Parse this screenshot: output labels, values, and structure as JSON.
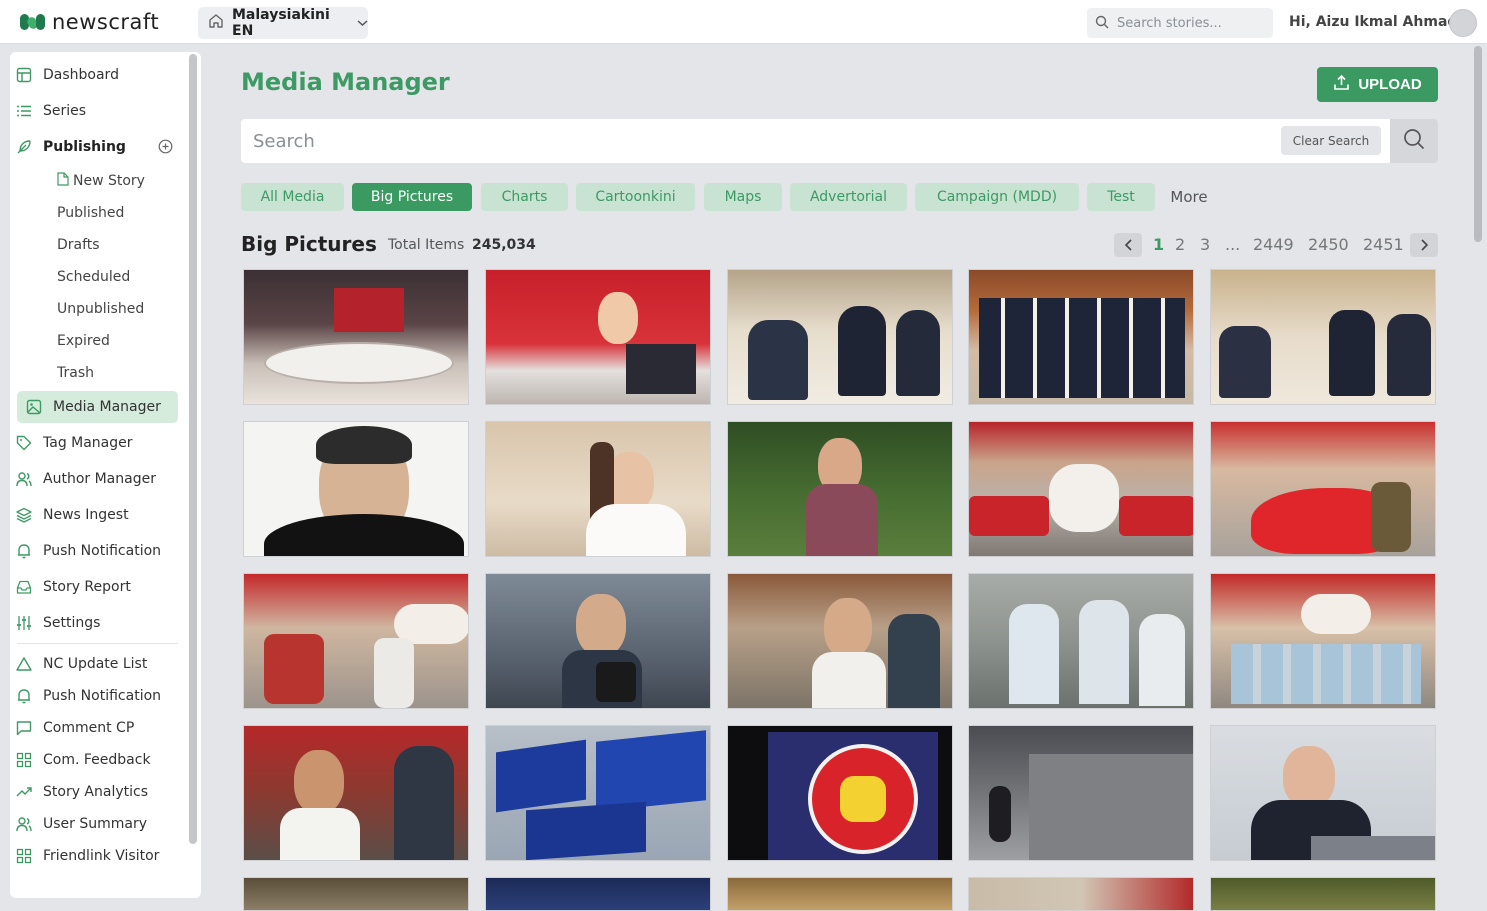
{
  "app": {
    "logo_text": "newscraft",
    "site_selector": "Malaysiakini EN",
    "search_placeholder": "Search stories...",
    "greeting": "Hi, Aizu Ikmal Ahmad"
  },
  "sidebar": {
    "items": [
      {
        "label": "Dashboard",
        "icon": "layout-icon"
      },
      {
        "label": "Series",
        "icon": "list-icon"
      },
      {
        "label": "Publishing",
        "icon": "feather-icon"
      },
      {
        "label": "Media Manager",
        "icon": "image-icon"
      },
      {
        "label": "Tag Manager",
        "icon": "tag-icon"
      },
      {
        "label": "Author Manager",
        "icon": "users-icon"
      },
      {
        "label": "News Ingest",
        "icon": "layers-icon"
      },
      {
        "label": "Push Notification",
        "icon": "bell-icon"
      },
      {
        "label": "Story Report",
        "icon": "inbox-icon"
      },
      {
        "label": "Settings",
        "icon": "sliders-icon"
      }
    ],
    "publishing_sub": [
      "New Story",
      "Published",
      "Drafts",
      "Scheduled",
      "Unpublished",
      "Expired",
      "Trash"
    ],
    "extra_items": [
      {
        "label": "NC Update List",
        "icon": "triangle-icon"
      },
      {
        "label": "Push Notification",
        "icon": "bell-icon"
      },
      {
        "label": "Comment CP",
        "icon": "message-icon"
      },
      {
        "label": "Com. Feedback",
        "icon": "grid-icon"
      },
      {
        "label": "Story Analytics",
        "icon": "trending-icon"
      },
      {
        "label": "User Summary",
        "icon": "users-icon"
      },
      {
        "label": "Friendlink Visitor",
        "icon": "grid-icon"
      }
    ]
  },
  "main": {
    "title": "Media Manager",
    "upload_label": "UPLOAD",
    "search_placeholder": "Search",
    "clear_label": "Clear Search",
    "tabs": [
      "All Media",
      "Big Pictures",
      "Charts",
      "Cartoonkini",
      "Maps",
      "Advertorial",
      "Campaign (MDD)",
      "Test",
      "More"
    ],
    "active_tab": "Big Pictures",
    "section_title": "Big Pictures",
    "total_label": "Total Items",
    "total_value": "245,034",
    "pagination": [
      "1",
      "2",
      "3",
      "...",
      "2449",
      "2450",
      "2451"
    ]
  },
  "colors": {
    "accent": "#3a9a62",
    "accent_light": "#c9e3d2",
    "title": "#3d9a64"
  }
}
